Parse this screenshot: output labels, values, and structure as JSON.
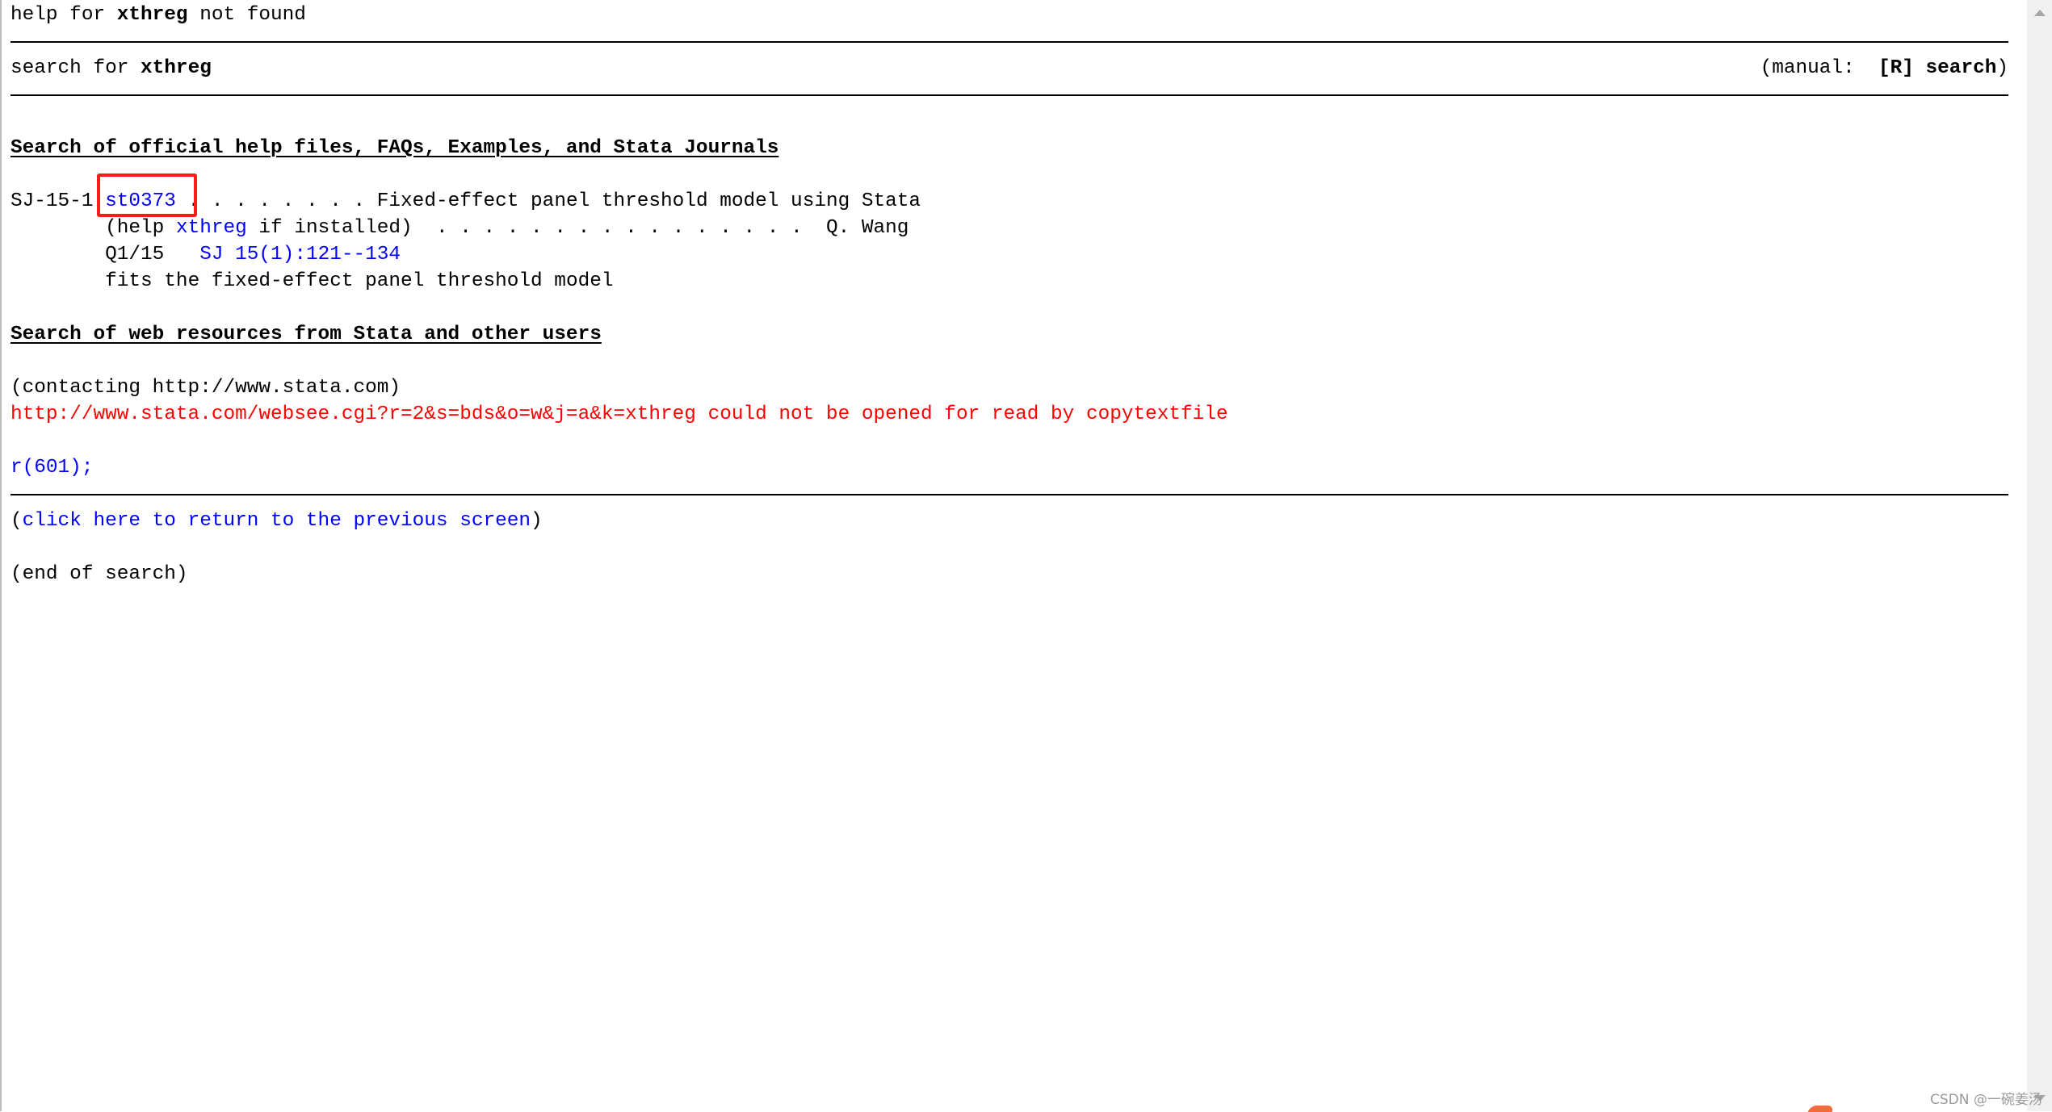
{
  "header": {
    "prefix": "help for ",
    "command": "xthreg",
    "suffix": " not found"
  },
  "search_line": {
    "prefix": "search for ",
    "command": "xthreg",
    "manual_prefix": "(manual:  ",
    "manual_ref": "[R] search",
    "manual_suffix": ")"
  },
  "official": {
    "title": "Search of official help files, FAQs, Examples, and Stata Journals",
    "entry": {
      "id": "SJ-15-1",
      "package": "st0373",
      "dots1": " . . . . . . . . ",
      "title": "Fixed-effect panel threshold model using Stata",
      "help_prefix": "(help ",
      "help_cmd": "xthreg",
      "help_suffix": " if installed)",
      "dots2": "  . . . . . . . . . . . . . . . .  ",
      "author": "Q. Wang",
      "issue": "Q1/15",
      "citation": "SJ 15(1):121--134",
      "description": "fits the fixed-effect panel threshold model"
    }
  },
  "web": {
    "title": "Search of web resources from Stata and other users",
    "contacting": "(contacting http://www.stata.com)",
    "error": "http://www.stata.com/websee.cgi?r=2&s=bds&o=w&j=a&k=xthreg could not be opened for read by copytextfile",
    "return_code": "r(601);"
  },
  "footer": {
    "open": "(",
    "return_link": "click here to return to the previous screen",
    "close": ")",
    "end": "(end of search)"
  },
  "watermark": "CSDN @一碗姜汤",
  "colors": {
    "link": "#0000ff",
    "error": "#ff0000",
    "highlight_box": "#ff1a1a"
  }
}
